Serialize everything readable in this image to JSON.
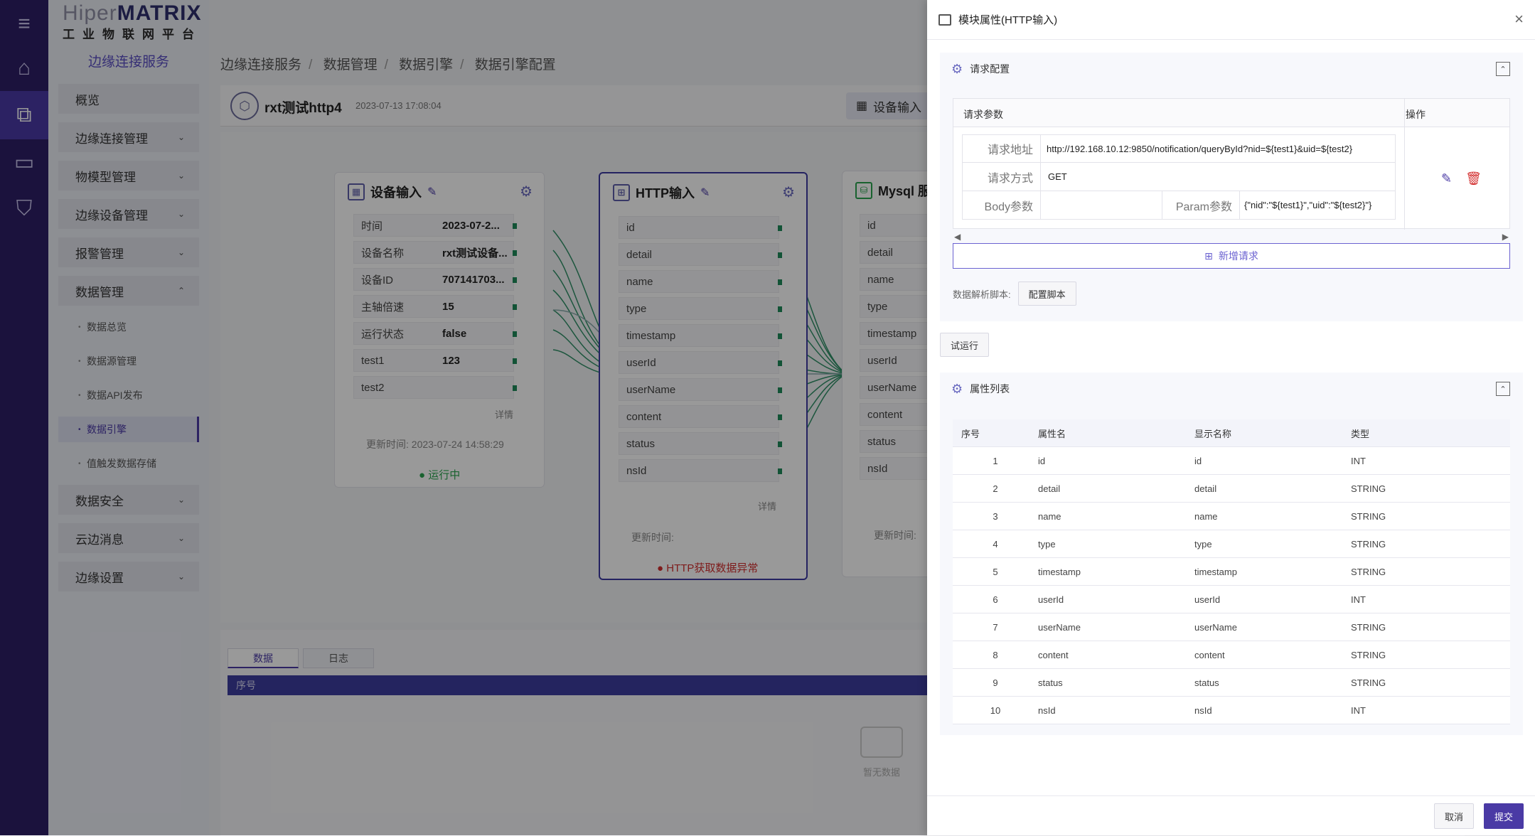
{
  "rail": {
    "icons": [
      "menu-icon",
      "home-icon",
      "connect-icon",
      "monitor-icon",
      "shield-icon"
    ]
  },
  "logo": {
    "line1a": "Hiper",
    "line1b": "MATRIX",
    "line2": "工业物联网平台"
  },
  "sidebar": {
    "title": "边缘连接服务",
    "items": [
      {
        "label": "概览"
      },
      {
        "label": "边缘连接管理",
        "arrow": "⌄"
      },
      {
        "label": "物模型管理",
        "arrow": "⌄"
      },
      {
        "label": "边缘设备管理",
        "arrow": "⌄"
      },
      {
        "label": "报警管理",
        "arrow": "⌄"
      },
      {
        "label": "数据管理",
        "arrow": "⌃"
      }
    ],
    "subitems": [
      "数据总览",
      "数据源管理",
      "数据API发布",
      "数据引擎",
      "值触发数据存储"
    ],
    "items2": [
      {
        "label": "数据安全",
        "arrow": "⌄"
      },
      {
        "label": "云边消息",
        "arrow": "⌄"
      },
      {
        "label": "边缘设置",
        "arrow": "⌄"
      }
    ]
  },
  "breadcrumb": [
    "边缘连接服务",
    "数据管理",
    "数据引擎",
    "数据引擎配置"
  ],
  "engine": {
    "name": "rxt测试http4",
    "time": "2023-07-13 17:08:04",
    "device_btn": "设备输入"
  },
  "nodes": {
    "device": {
      "title": "设备输入",
      "fields": [
        {
          "k": "时间",
          "v": "2023-07-2..."
        },
        {
          "k": "设备名称",
          "v": "rxt测试设备..."
        },
        {
          "k": "设备ID",
          "v": "707141703..."
        },
        {
          "k": "主轴倍速",
          "v": "15"
        },
        {
          "k": "运行状态",
          "v": "false"
        },
        {
          "k": "test1",
          "v": "123"
        },
        {
          "k": "test2",
          "v": ""
        }
      ],
      "more": "详情",
      "update": "更新时间:  2023-07-24 14:58:29",
      "status": "运行中"
    },
    "http": {
      "title": "HTTP输入",
      "fields": [
        "id",
        "detail",
        "name",
        "type",
        "timestamp",
        "userId",
        "userName",
        "content",
        "status",
        "nsId"
      ],
      "more": "详情",
      "update": "更新时间:",
      "status": "HTTP获取数据异常"
    },
    "mysql": {
      "title": "Mysql 服",
      "fields": [
        "id",
        "detail",
        "name",
        "type",
        "timestamp",
        "userId",
        "userName",
        "content",
        "status",
        "nsId"
      ],
      "update": "更新时间:"
    }
  },
  "bottom": {
    "tab_data": "数据",
    "tab_log": "日志",
    "col_index": "序号",
    "empty": "暂无数据"
  },
  "drawer": {
    "title": "模块属性(HTTP输入)",
    "close": "×",
    "req_section": "请求配置",
    "req_params_header": "请求参数",
    "ops_header": "操作",
    "url_label": "请求地址",
    "url_value": "http://192.168.10.12:9850/notification/queryById?nid=${test1}&uid=${test2}",
    "method_label": "请求方式",
    "method_value": "GET",
    "body_label": "Body参数",
    "body_value": "",
    "param_label": "Param参数",
    "param_value": "{\"nid\":\"${test1}\",\"uid\":\"${test2}\"}",
    "add_request": "新增请求",
    "script_label": "数据解析脚本:",
    "script_btn": "配置脚本",
    "trial_btn": "试运行",
    "attr_section": "属性列表",
    "attr_headers": [
      "序号",
      "属性名",
      "显示名称",
      "类型"
    ],
    "attrs": [
      {
        "i": "1",
        "name": "id",
        "disp": "id",
        "type": "INT"
      },
      {
        "i": "2",
        "name": "detail",
        "disp": "detail",
        "type": "STRING"
      },
      {
        "i": "3",
        "name": "name",
        "disp": "name",
        "type": "STRING"
      },
      {
        "i": "4",
        "name": "type",
        "disp": "type",
        "type": "STRING"
      },
      {
        "i": "5",
        "name": "timestamp",
        "disp": "timestamp",
        "type": "STRING"
      },
      {
        "i": "6",
        "name": "userId",
        "disp": "userId",
        "type": "INT"
      },
      {
        "i": "7",
        "name": "userName",
        "disp": "userName",
        "type": "STRING"
      },
      {
        "i": "8",
        "name": "content",
        "disp": "content",
        "type": "STRING"
      },
      {
        "i": "9",
        "name": "status",
        "disp": "status",
        "type": "STRING"
      },
      {
        "i": "10",
        "name": "nsId",
        "disp": "nsId",
        "type": "INT"
      }
    ],
    "cancel": "取消",
    "submit": "提交"
  },
  "colors": {
    "accent": "#4a3aa5",
    "rail": "#2d1f66",
    "ok": "#2aa44f",
    "err": "#d32f2f"
  }
}
